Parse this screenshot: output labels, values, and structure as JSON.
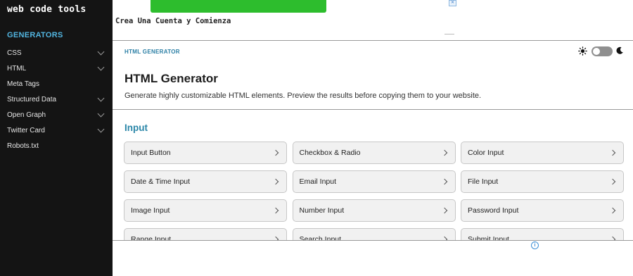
{
  "sidebar": {
    "logo": "web code tools",
    "heading": "GENERATORS",
    "items": [
      {
        "label": "CSS",
        "expandable": true
      },
      {
        "label": "HTML",
        "expandable": true
      },
      {
        "label": "Meta Tags",
        "expandable": false
      },
      {
        "label": "Structured Data",
        "expandable": true
      },
      {
        "label": "Open Graph",
        "expandable": true
      },
      {
        "label": "Twitter Card",
        "expandable": true
      },
      {
        "label": "Robots.txt",
        "expandable": false
      }
    ]
  },
  "ad": {
    "text": "Crea Una Cuenta y Comienza",
    "button_color": "#2dbd2d"
  },
  "header": {
    "breadcrumb": "HTML GENERATOR",
    "theme_toggle": {
      "state": "light",
      "icons": [
        "sun-icon",
        "moon-icon"
      ]
    }
  },
  "main": {
    "title": "HTML Generator",
    "description": "Generate highly customizable HTML elements. Preview the results before copying them to your website.",
    "section": "Input",
    "cards": [
      "Input Button",
      "Checkbox & Radio",
      "Color Input",
      "Date & Time Input",
      "Email Input",
      "File Input",
      "Image Input",
      "Number Input",
      "Password Input",
      "Range Input",
      "Search Input",
      "Submit Input"
    ]
  },
  "colors": {
    "sidebar_bg": "#141414",
    "accent_blue": "#2a86a8",
    "sidebar_heading": "#52b5e0"
  }
}
